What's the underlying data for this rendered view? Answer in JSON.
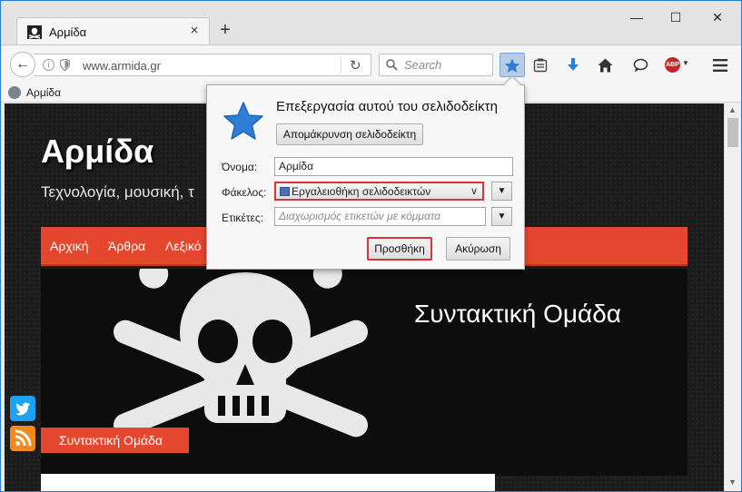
{
  "window": {
    "minimize_glyph": "—",
    "maximize_glyph": "☐",
    "close_glyph": "✕",
    "frame_color": "#2b7bd6"
  },
  "tab": {
    "title": "Αρμίδα",
    "close_glyph": "×",
    "favicon": "pirate-flag-icon"
  },
  "newtab_glyph": "+",
  "navbar": {
    "back_glyph": "←",
    "url": "www.armida.gr",
    "reload_glyph": "↻",
    "search_placeholder": "Search"
  },
  "toolbar_icons": [
    "bookmark-star-icon",
    "reading-list-icon",
    "downloads-icon",
    "home-icon",
    "chat-icon",
    "adblock-plus-icon",
    "menu-icon"
  ],
  "abp_label": "ABP",
  "bookmarks_bar": {
    "item_label": "Αρμίδα"
  },
  "site": {
    "title": "Αρμίδα",
    "subtitle": "Τεχνολογία, μουσική, τ",
    "nav": [
      "Αρχική",
      "Άρθρα",
      "Λεξικό"
    ],
    "hero_title": "Συντακτική Ομάδα",
    "hero_tag": "Συντακτική Ομάδα",
    "accent_color": "#e5472e"
  },
  "popup": {
    "title": "Επεξεργασία αυτού του σελιδοδείκτη",
    "remove_button": "Απομάκρυνση σελιδοδείκτη",
    "name_label": "Όνομα:",
    "name_value": "Αρμίδα",
    "folder_label": "Φάκελος:",
    "folder_value": "Εργαλειοθήκη σελιδοδεικτών",
    "tags_label": "Ετικέτες:",
    "tags_placeholder": "Διαχωρισμός ετικετών με κόμματα",
    "add_button": "Προσθήκη",
    "cancel_button": "Ακύρωση",
    "highlight_color": "#d8343b"
  }
}
